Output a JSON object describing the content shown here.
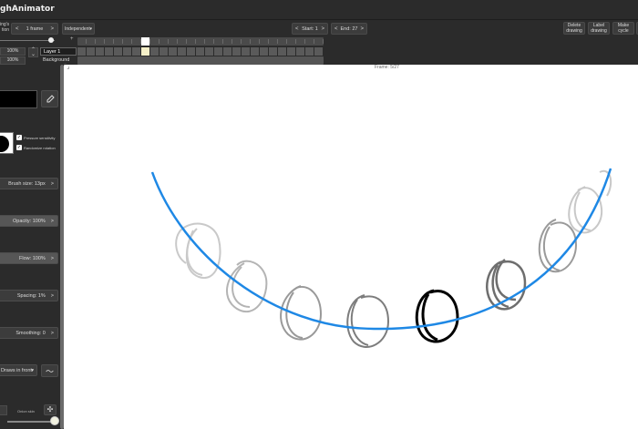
{
  "app": {
    "title": "ghAnimator"
  },
  "toolbar": {
    "onion_label": "ing's\ntion",
    "frames_prev": "<",
    "frames_value": "1 frame",
    "frames_next": ">",
    "mode": "Independent",
    "mode_icon": "chevron-down-icon",
    "start_prev": "<",
    "start_label": "Start: 1",
    "start_next": ">",
    "end_prev": "<",
    "end_label": "End: 27",
    "end_next": ">",
    "delete_drawing": "Delete\ndrawing",
    "label_drawing": "Label\ndrawing",
    "make_cycle": "Make\ncycle"
  },
  "timeline": {
    "zoom1": "100%",
    "zoom2": "100%",
    "layers": [
      "Layer 1",
      "Background"
    ],
    "current_frame": 7,
    "total_frames": 27,
    "frame_marker": "Frame: 5/27"
  },
  "sidebar": {
    "pressure_sensitivity": "Pressure sensitivity",
    "randomize_rotation": "Randomize rotation",
    "brush_size": "Brush size: 13px",
    "opacity": "Opacity: 100%",
    "flow": "Flow: 100%",
    "spacing": "Spacing: 1%",
    "smoothing": "Smoothing: 0",
    "draws_mode": "Draws in front",
    "draws_mode_icon": "chevron-down-icon",
    "stroke_icon": "wave-stroke-icon",
    "onion_skin_label": "Onion skin",
    "onion_skin_level": 0.9,
    "arrow": ">"
  },
  "colors": {
    "ui_bg": "#2b2b2b",
    "control_bg": "#3c3c3c",
    "path_blue": "#1e88e5",
    "current_frame_marker": "#f5f0c8",
    "stroke_black": "#000000"
  }
}
